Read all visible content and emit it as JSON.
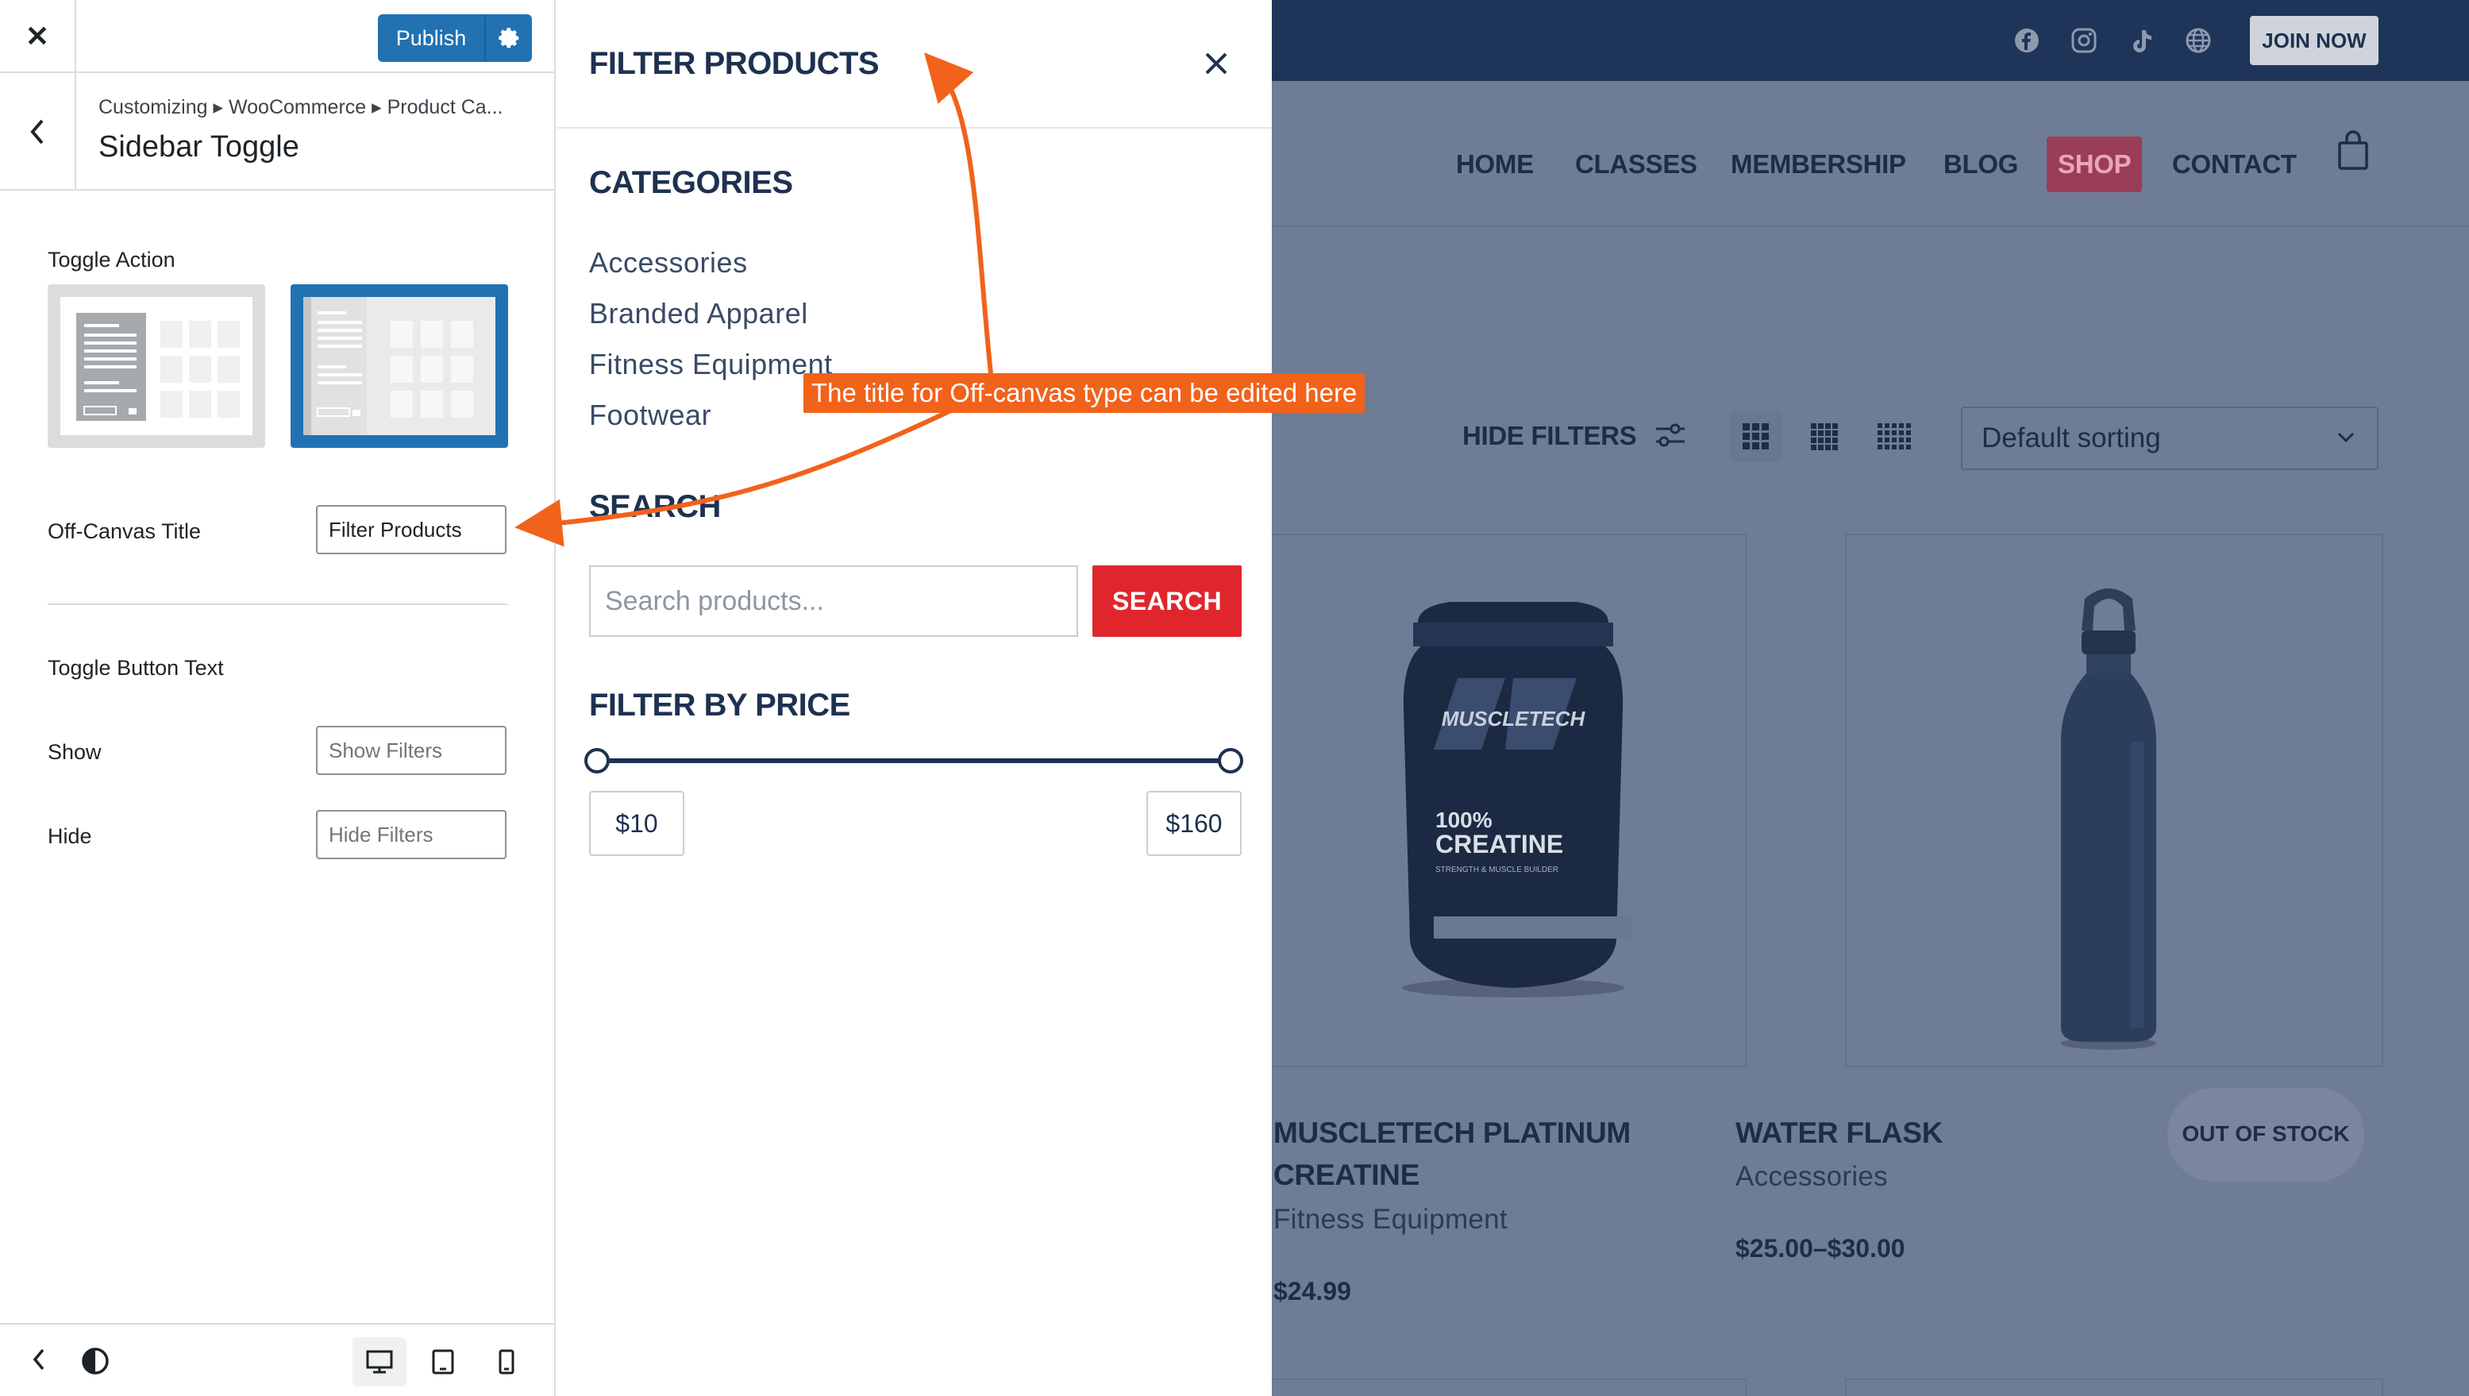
{
  "customizer": {
    "publish_label": "Publish",
    "breadcrumb": "Customizing ▸ WooCommerce ▸ Product Ca...",
    "section_title": "Sidebar Toggle",
    "toggle_action_label": "Toggle Action",
    "offcanvas_title_label": "Off-Canvas Title",
    "offcanvas_title_value": "Filter Products",
    "toggle_button_text_label": "Toggle Button Text",
    "show_label": "Show",
    "show_placeholder": "Show Filters",
    "hide_label": "Hide",
    "hide_placeholder": "Hide Filters",
    "accent_color": "#2271b1"
  },
  "drawer": {
    "title": "FILTER PRODUCTS",
    "categories_heading": "CATEGORIES",
    "categories": [
      "Accessories",
      "Branded Apparel",
      "Fitness Equipment",
      "Footwear"
    ],
    "search_heading": "SEARCH",
    "search_placeholder": "Search products...",
    "search_button": "SEARCH",
    "price_heading": "FILTER BY PRICE",
    "price_min": "$10",
    "price_max": "$160",
    "accent_color": "#e0262d"
  },
  "site": {
    "join_label": "JOIN NOW",
    "social_icons": [
      "facebook-icon",
      "instagram-icon",
      "tiktok-icon",
      "globe-icon"
    ],
    "nav": [
      "HOME",
      "CLASSES",
      "MEMBERSHIP",
      "BLOG",
      "SHOP",
      "CONTACT"
    ],
    "active_nav": "SHOP",
    "hide_filters_label": "HIDE FILTERS",
    "sorting": "Default sorting",
    "products": [
      {
        "title_line1": "MUSCLETECH PLATINUM",
        "title_line2": "CREATINE",
        "category": "Fitness Equipment",
        "price": "$24.99",
        "badge": ""
      },
      {
        "title_line1": "WATER FLASK",
        "title_line2": "",
        "category": "Accessories",
        "price": "$25.00–$30.00",
        "badge": "OUT OF STOCK"
      }
    ],
    "product_art": {
      "brand": "MUSCLETECH",
      "line1": "100%",
      "line2": "CREATINE",
      "line3": "STRENGTH & MUSCLE BUILDER"
    }
  },
  "annotation": {
    "text": "The title for Off-canvas type can be edited here",
    "color": "#f1621b"
  }
}
